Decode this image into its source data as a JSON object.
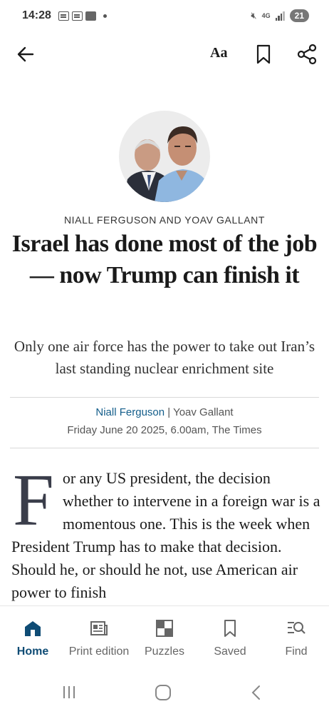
{
  "status_bar": {
    "time": "14:28",
    "network": "4G",
    "battery": "21"
  },
  "toolbar": {
    "font_label": "Aa"
  },
  "article": {
    "kicker": "NIALL FERGUSON AND YOAV GALLANT",
    "headline": "Israel has done most of the job — now Trump can finish it",
    "standfirst": "Only one air force has the power to take out Iran’s last standing nuclear enrichment site",
    "author_1": "Niall Ferguson",
    "separator": " | ",
    "author_2": "Yoav Gallant",
    "dateline": "Friday June 20 2025, 6.00am, The Times",
    "dropcap": "F",
    "body": "or any US president, the decision whether to intervene in a foreign war is a momentous one. This is the week when President Trump has to make that decision. Should he, or should he not, use American air power to finish"
  },
  "bottom_nav": {
    "items": [
      {
        "label": "Home",
        "icon": "home-icon",
        "active": true
      },
      {
        "label": "Print edition",
        "icon": "newspaper-icon",
        "active": false
      },
      {
        "label": "Puzzles",
        "icon": "puzzle-icon",
        "active": false
      },
      {
        "label": "Saved",
        "icon": "bookmark-icon",
        "active": false
      },
      {
        "label": "Find",
        "icon": "search-list-icon",
        "active": false
      }
    ]
  },
  "colors": {
    "accent": "#0f4c75",
    "link": "#135d8a"
  }
}
